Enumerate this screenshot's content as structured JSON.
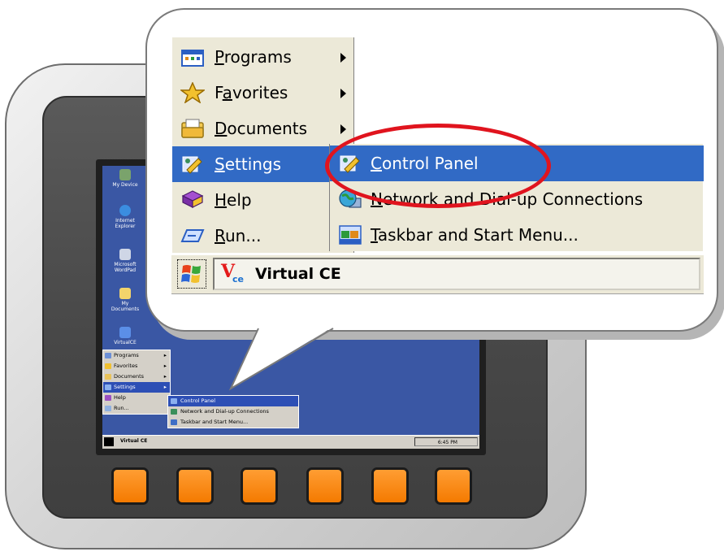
{
  "device": {
    "hardware_buttons": 6,
    "colors": {
      "button": "#f47a00",
      "bezel": "#474747",
      "shell": "#d6d6d6"
    }
  },
  "device_screen": {
    "desktop_icons": [
      {
        "label": "My Device",
        "icon": "my-device-icon"
      },
      {
        "label": "Internet Explorer",
        "icon": "internet-explorer-icon"
      },
      {
        "label": "Microsoft WordPad",
        "icon": "wordpad-icon"
      },
      {
        "label": "My Documents",
        "icon": "my-documents-icon"
      },
      {
        "label": "VirtualCE",
        "icon": "virtualce-icon"
      }
    ],
    "start_menu": [
      {
        "label": "Programs",
        "submenu": true
      },
      {
        "label": "Favorites",
        "submenu": true
      },
      {
        "label": "Documents",
        "submenu": true
      },
      {
        "label": "Settings",
        "submenu": true,
        "selected": true
      },
      {
        "label": "Help"
      },
      {
        "label": "Run..."
      }
    ],
    "settings_submenu": [
      {
        "label": "Control Panel",
        "selected": true
      },
      {
        "label": "Network and Dial-up Connections"
      },
      {
        "label": "Taskbar and Start Menu..."
      }
    ],
    "taskbar": {
      "title": "Virtual CE",
      "clock": "6:45 PM"
    }
  },
  "zoom": {
    "start_menu": [
      {
        "label_underline": "P",
        "label_rest": "rograms",
        "icon": "programs-icon",
        "submenu": true
      },
      {
        "label_prefix": "F",
        "label_underline": "a",
        "label_rest": "vorites",
        "icon": "favorites-star-icon",
        "submenu": true
      },
      {
        "label_underline": "D",
        "label_rest": "ocuments",
        "icon": "documents-icon",
        "submenu": true
      },
      {
        "label_underline": "S",
        "label_rest": "ettings",
        "icon": "settings-icon",
        "submenu": true,
        "selected": true
      },
      {
        "label_underline": "H",
        "label_rest": "elp",
        "icon": "help-book-icon"
      },
      {
        "label_underline": "R",
        "label_rest": "un...",
        "icon": "run-icon"
      }
    ],
    "settings_submenu": [
      {
        "label_underline": "C",
        "label_rest": "ontrol Panel",
        "icon": "control-panel-icon",
        "selected": true
      },
      {
        "label_underline": "N",
        "label_rest": "etwork and Dial-up Connections",
        "icon": "network-globe-icon"
      },
      {
        "label_underline": "T",
        "label_rest": "askbar and Start Menu...",
        "icon": "taskbar-icon"
      }
    ],
    "taskbar": {
      "app_title": "Virtual CE",
      "logo_v": "V",
      "logo_ce": "ce"
    },
    "highlight": {
      "target": "Control Panel",
      "color": "#e0141e"
    },
    "colors": {
      "selection": "#316ac5",
      "menu_bg": "#ece9d8"
    }
  }
}
